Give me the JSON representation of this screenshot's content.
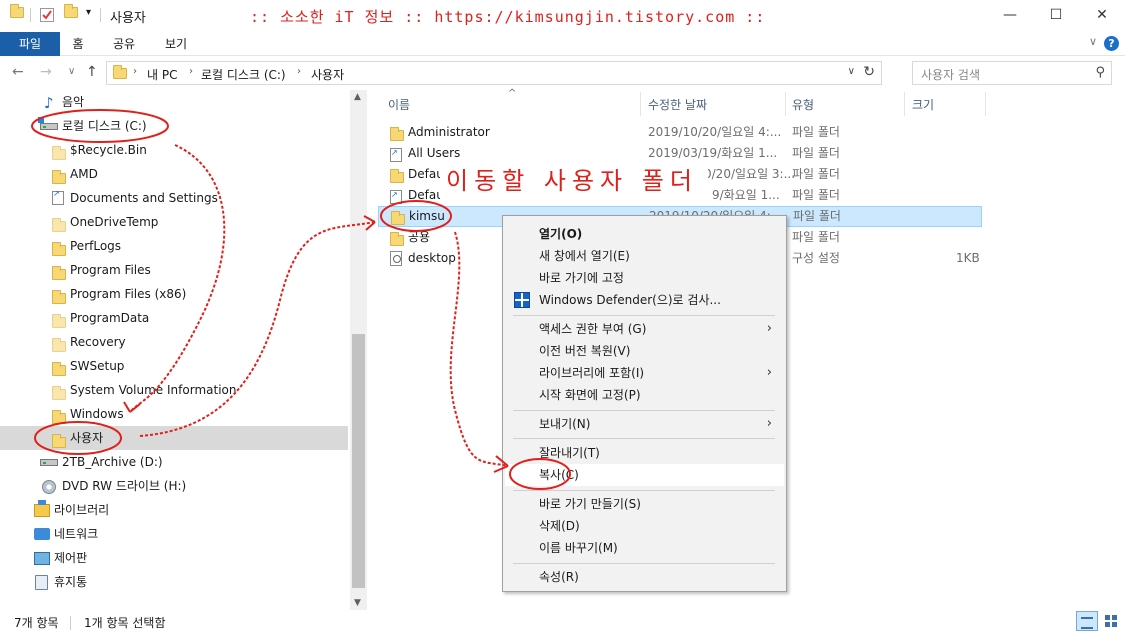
{
  "titlebar": {
    "title": "사용자",
    "banner": ":: 소소한 iT 정보 :: https://kimsungjin.tistory.com ::",
    "minimize": "—",
    "maximize": "☐",
    "close": "✕",
    "dropdown": "▾"
  },
  "ribbon": {
    "tabs": [
      "파일",
      "홈",
      "공유",
      "보기"
    ],
    "collapse": "∨",
    "help": "?"
  },
  "nav": {
    "back": "←",
    "forward": "→",
    "recent": "∨",
    "up": "↑",
    "breadcrumb": [
      "내 PC",
      "로컬 디스크 (C:)",
      "사용자"
    ],
    "separator": "›",
    "dropdown": "∨",
    "refresh": "↻"
  },
  "search": {
    "placeholder": "사용자 검색",
    "icon": "⚲"
  },
  "tree": [
    {
      "label": "음악",
      "icon": "music-icon"
    },
    {
      "label": "로컬 디스크 (C:)",
      "icon": "drive-icon"
    },
    {
      "label": "$Recycle.Bin",
      "icon": "folder-icon"
    },
    {
      "label": "AMD",
      "icon": "folder-icon"
    },
    {
      "label": "Documents and Settings",
      "icon": "shortcut-icon"
    },
    {
      "label": "OneDriveTemp",
      "icon": "folder-icon"
    },
    {
      "label": "PerfLogs",
      "icon": "folder-icon"
    },
    {
      "label": "Program Files",
      "icon": "folder-icon"
    },
    {
      "label": "Program Files (x86)",
      "icon": "folder-icon"
    },
    {
      "label": "ProgramData",
      "icon": "folder-icon"
    },
    {
      "label": "Recovery",
      "icon": "folder-icon"
    },
    {
      "label": "SWSetup",
      "icon": "folder-icon"
    },
    {
      "label": "System Volume Information",
      "icon": "folder-icon"
    },
    {
      "label": "Windows",
      "icon": "folder-icon"
    },
    {
      "label": "사용자",
      "icon": "folder-icon"
    },
    {
      "label": "2TB_Archive (D:)",
      "icon": "drive-icon"
    },
    {
      "label": "DVD RW 드라이브 (H:)",
      "icon": "dvd-icon"
    },
    {
      "label": "라이브러리",
      "icon": "library-icon"
    },
    {
      "label": "네트워크",
      "icon": "network-icon"
    },
    {
      "label": "제어판",
      "icon": "control-panel-icon"
    },
    {
      "label": "휴지통",
      "icon": "recycle-bin-icon"
    }
  ],
  "columns": [
    "이름",
    "수정한 날짜",
    "유형",
    "크기"
  ],
  "sort_arrow": "^",
  "files": [
    {
      "name": "Administrator",
      "date": "2019/10/20/일요일 4:...",
      "type": "파일 폴더",
      "size": ""
    },
    {
      "name": "All Users",
      "date": "2019/03/19/화요일 1...",
      "type": "파일 폴더",
      "size": ""
    },
    {
      "name": "Defau",
      "date": "0/20/일요일 3:...",
      "type": "파일 폴더",
      "size": ""
    },
    {
      "name": "Defau",
      "date": "9/화요일 1...",
      "type": "파일 폴더",
      "size": ""
    },
    {
      "name": "kimsu",
      "date": "2019/10/20/일요일 4:...",
      "type": "파일 폴더",
      "size": ""
    },
    {
      "name": "공용",
      "date": "",
      "type": "파일 폴더",
      "size": ""
    },
    {
      "name": "desktop",
      "date": "",
      "type": "구성 설정",
      "size": "1KB"
    }
  ],
  "annotation": {
    "label": "이동할 사용자 폴더"
  },
  "context_menu": {
    "items": [
      "열기(O)",
      "새 창에서 열기(E)",
      "바로 가기에 고정",
      "Windows Defender(으)로 검사...",
      "액세스 권한 부여 (G)",
      "이전 버전 복원(V)",
      "라이브러리에 포함(I)",
      "시작 화면에 고정(P)",
      "보내기(N)",
      "잘라내기(T)",
      "복사(C)",
      "바로 가기 만들기(S)",
      "삭제(D)",
      "이름 바꾸기(M)",
      "속성(R)"
    ],
    "submenu_arrow": "›"
  },
  "statusbar": {
    "item_count": "7개 항목",
    "selection": "1개 항목 선택함"
  },
  "scrollbar": {
    "up": "▲",
    "down": "▼"
  },
  "colors": {
    "accent": "#1a5fa8",
    "annotation": "#e0201b",
    "selection": "#cce8ff"
  }
}
